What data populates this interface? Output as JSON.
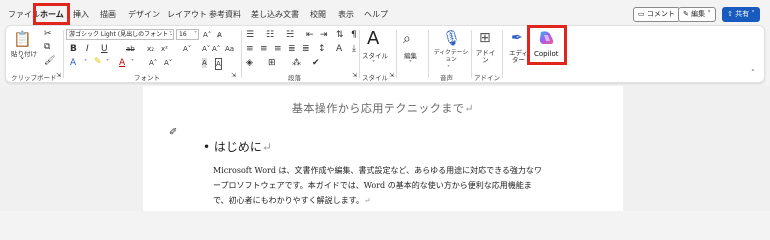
{
  "tabs": [
    "ファイル",
    "ホーム",
    "挿入",
    "描画",
    "デザイン",
    "レイアウト",
    "参考資料",
    "差し込み文書",
    "校閲",
    "表示",
    "ヘルプ"
  ],
  "header_buttons": {
    "comment": "コメント",
    "edit": "編集",
    "share": "共有"
  },
  "clipboard": {
    "paste": "貼り付け",
    "group": "クリップボード"
  },
  "font": {
    "name": "游ゴシック Light (見出しのフォント -",
    "size": "16",
    "bold": "B",
    "italic": "I",
    "underline": "U",
    "strike": "ab",
    "sub": "x₂",
    "sup": "x²",
    "clear": "A",
    "grow": "A˄",
    "shrink": "A˅",
    "case": "Aa",
    "color_a": "A",
    "group": "フォント"
  },
  "paragraph": {
    "group": "段落"
  },
  "styles": {
    "label": "スタイル",
    "group": "スタイル"
  },
  "editing": {
    "label": "編集"
  },
  "voice": {
    "label": "ディクテーション",
    "group": "音声"
  },
  "addins": {
    "label": "アドイン",
    "group": "アドイン"
  },
  "editor": {
    "label": "エディター"
  },
  "copilot": {
    "label": "Copilot"
  },
  "document": {
    "subtitle": "基本操作から応用テクニックまで",
    "heading": "はじめに",
    "para": [
      "Microsoft Word は、文書作成や編集、書式設定など、あらゆる用途に対応できる強力なワ",
      "ープロソフトウェアです。本ガイドでは、Word の基本的な使い方から便利な応用機能ま",
      "で、初心者にもわかりやすく解説します。"
    ],
    "return_mark": "↵"
  },
  "colors": {
    "accent": "#185abd",
    "highlight_box": "#e0261c"
  }
}
